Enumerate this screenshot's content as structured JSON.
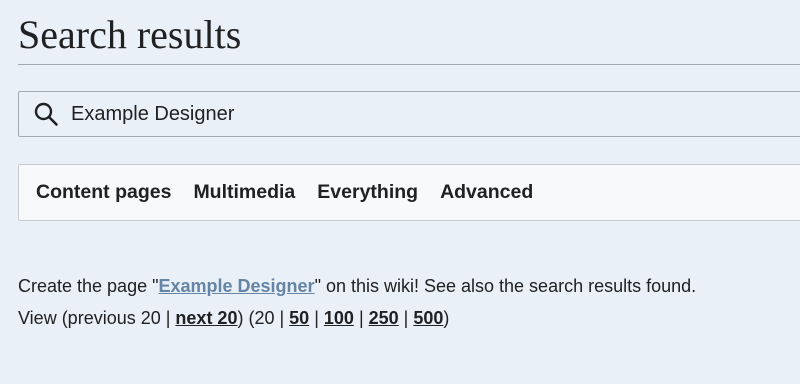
{
  "page": {
    "title": "Search results"
  },
  "search": {
    "value": "Example Designer",
    "icon": "search-icon"
  },
  "tabs": [
    {
      "label": "Content pages"
    },
    {
      "label": "Multimedia"
    },
    {
      "label": "Everything"
    },
    {
      "label": "Advanced"
    }
  ],
  "results": {
    "create_prefix": "Create the page \"",
    "create_link": "Example Designer",
    "create_suffix": "\" on this wiki! See also the search results found.",
    "view_prefix": "View (previous 20 | ",
    "next_link": "next 20",
    "middle": ") (20 | ",
    "counts": [
      "50",
      "100",
      "250",
      "500"
    ],
    "separator": " | ",
    "close": ")"
  },
  "colors": {
    "background": "#eaf0f8",
    "link": "#6485a6",
    "text": "#202122"
  }
}
